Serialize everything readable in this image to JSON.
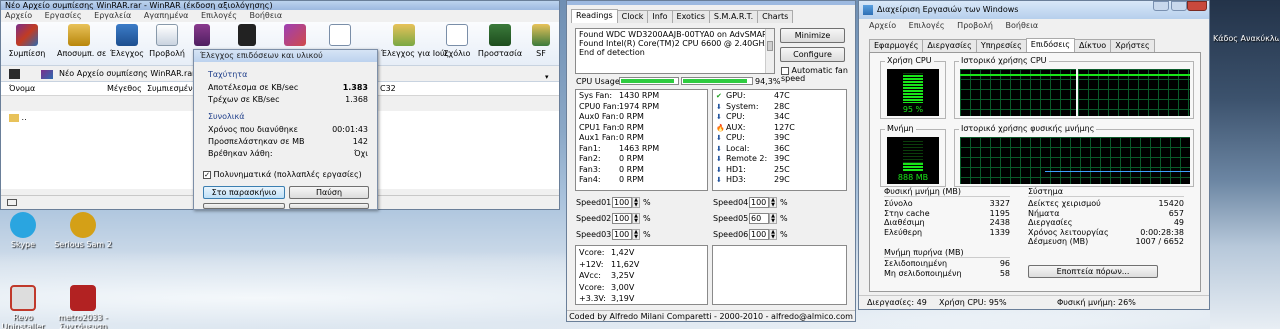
{
  "winrar": {
    "title": "Νέο Αρχείο συμπίεσης WinRAR.rar - WinRAR (έκδοση αξιολόγησης)",
    "menu": [
      "Αρχείο",
      "Εργασίες",
      "Εργαλεία",
      "Αγαπημένα",
      "Επιλογές",
      "Βοήθεια"
    ],
    "toolbar": [
      "Συμπίεση",
      "Αποσυμπ. σε",
      "Έλεγχος",
      "Προβολή",
      "",
      "",
      "",
      "",
      "Έλεγχος για Ιούς",
      "Σχόλιο",
      "Προστασία",
      "SF"
    ],
    "address": "Νέο Αρχείο συμπίεσης WinRAR.rar - R",
    "columns": [
      "Όνομα",
      "Μέγεθος",
      "Συμπιεσμένο",
      "C32"
    ],
    "rows": [
      ".."
    ]
  },
  "dialog": {
    "title": "Έλεγχος επιδόσεων και υλικού",
    "speed_label": "Ταχύτητα",
    "result_label": "Αποτέλεσμα σε KB/sec",
    "result_value": "1.383",
    "current_label": "Τρέχων σε KB/sec",
    "current_value": "1.368",
    "totals_label": "Συνολικά",
    "elapsed_label": "Χρόνος που διανύθηκε",
    "elapsed_value": "00:01:43",
    "processed_label": "Προσπελάστηκαν σε MB",
    "processed_value": "142",
    "errors_label": "Βρέθηκαν λάθη:",
    "errors_value": "Όχι",
    "multithread_label": "Πολυνηματικά (πολλαπλές εργασίες)",
    "background_button": "Στο παρασκήνιο",
    "pause_button": "Παύση"
  },
  "speedfan": {
    "tabs": [
      "Readings",
      "Clock",
      "Info",
      "Exotics",
      "S.M.A.R.T.",
      "Charts"
    ],
    "log": [
      "Found WDC WD3200AAJB-00TYA0 on AdvSMART",
      "Found Intel(R) Core(TM)2 CPU 6600 @ 2.40GHz",
      "End of detection"
    ],
    "minimize_button": "Minimize",
    "configure_button": "Configure",
    "auto_fan_label": "Automatic fan speed",
    "cpu_usage_label": "CPU Usage",
    "cpu_usage_value": "94,3%",
    "cpu_usage_fraction": 0.943,
    "fans": [
      {
        "name": "Sys Fan:",
        "value": "1430 RPM"
      },
      {
        "name": "CPU0 Fan:",
        "value": "1974 RPM"
      },
      {
        "name": "Aux0 Fan:",
        "value": "0 RPM"
      },
      {
        "name": "CPU1 Fan:",
        "value": "0 RPM"
      },
      {
        "name": "Aux1 Fan:",
        "value": "0 RPM"
      },
      {
        "name": "Fan1:",
        "value": "1463 RPM"
      },
      {
        "name": "Fan2:",
        "value": "0 RPM"
      },
      {
        "name": "Fan3:",
        "value": "0 RPM"
      },
      {
        "name": "Fan4:",
        "value": "0 RPM"
      }
    ],
    "temps": [
      {
        "icon": "check",
        "name": "GPU:",
        "value": "47C"
      },
      {
        "icon": "down",
        "name": "System:",
        "value": "28C"
      },
      {
        "icon": "down",
        "name": "CPU:",
        "value": "34C"
      },
      {
        "icon": "flame",
        "name": "AUX:",
        "value": "127C"
      },
      {
        "icon": "down",
        "name": "CPU:",
        "value": "39C"
      },
      {
        "icon": "down",
        "name": "Local:",
        "value": "36C"
      },
      {
        "icon": "down",
        "name": "Remote 2:",
        "value": "39C"
      },
      {
        "icon": "down",
        "name": "HD1:",
        "value": "25C"
      },
      {
        "icon": "down",
        "name": "HD3:",
        "value": "29C"
      }
    ],
    "speeds_left": [
      {
        "name": "Speed01:",
        "value": "100",
        "unit": "%"
      },
      {
        "name": "Speed02:",
        "value": "100",
        "unit": "%"
      },
      {
        "name": "Speed03:",
        "value": "100",
        "unit": "%"
      }
    ],
    "speeds_right": [
      {
        "name": "Speed04:",
        "value": "100",
        "unit": "%"
      },
      {
        "name": "Speed05:",
        "value": "60",
        "unit": "%"
      },
      {
        "name": "Speed06:",
        "value": "100",
        "unit": "%"
      }
    ],
    "voltages": [
      {
        "name": "Vcore:",
        "value": "1,42V"
      },
      {
        "name": "+12V:",
        "value": "11,62V"
      },
      {
        "name": "AVcc:",
        "value": "3,25V"
      },
      {
        "name": "Vcore:",
        "value": "3,00V"
      },
      {
        "name": "+3.3V:",
        "value": "3,19V"
      }
    ],
    "status": "Coded by Alfredo Milani Comparetti - 2000-2010 - alfredo@almico.com"
  },
  "taskmgr": {
    "title": "Διαχείριση Εργασιών των Windows",
    "menu": [
      "Αρχείο",
      "Επιλογές",
      "Προβολή",
      "Βοήθεια"
    ],
    "tabs": [
      "Εφαρμογές",
      "Διεργασίες",
      "Υπηρεσίες",
      "Επιδόσεις",
      "Δίκτυο",
      "Χρήστες"
    ],
    "active_tab": 3,
    "cpu_usage_label": "Χρήση CPU",
    "cpu_usage_value": "95 %",
    "cpu_usage_fraction": 0.95,
    "cpu_history_label": "Ιστορικό χρήσης CPU",
    "memory_label": "Μνήμη",
    "memory_value": "888 MB",
    "memory_fraction": 0.27,
    "memory_history_label": "Ιστορικό χρήσης φυσικής μνήμης",
    "physical_memory_label": "Φυσική μνήμη (MB)",
    "physical_memory": [
      {
        "name": "Σύνολο",
        "value": "3327"
      },
      {
        "name": "Στην cache",
        "value": "1195"
      },
      {
        "name": "Διαθέσιμη",
        "value": "2438"
      },
      {
        "name": "Ελεύθερη",
        "value": "1339"
      }
    ],
    "kernel_memory_label": "Μνήμη πυρήνα (MB)",
    "kernel_memory": [
      {
        "name": "Σελιδοποιημένη",
        "value": "96"
      },
      {
        "name": "Μη σελιδοποιημένη",
        "value": "58"
      }
    ],
    "system_label": "Σύστημα",
    "system": [
      {
        "name": "Δείκτες χειρισμού",
        "value": "15420"
      },
      {
        "name": "Νήματα",
        "value": "657"
      },
      {
        "name": "Διεργασίες",
        "value": "49"
      },
      {
        "name": "Χρόνος λειτουργίας",
        "value": "0:00:28:38"
      },
      {
        "name": "Δέσμευση (MB)",
        "value": "1007 / 6652"
      }
    ],
    "resource_monitor_button": "Εποπτεία πόρων...",
    "status_processes": "Διεργασίες: 49",
    "status_cpu": "Χρήση CPU: 95%",
    "status_memory": "Φυσική μνήμη: 26%"
  },
  "desktop": {
    "icons": [
      {
        "label": "Skype",
        "color": "#2aa5e0"
      },
      {
        "label": "Serious Sam 2",
        "color": "#d4a017"
      },
      {
        "label": "Revo Uninstaller",
        "color": "#c0392b"
      },
      {
        "label": "metro2033 - Συντόμευση",
        "color": "#b22222"
      }
    ],
    "right_text": "Κάδος Ανακύκλωσης"
  }
}
